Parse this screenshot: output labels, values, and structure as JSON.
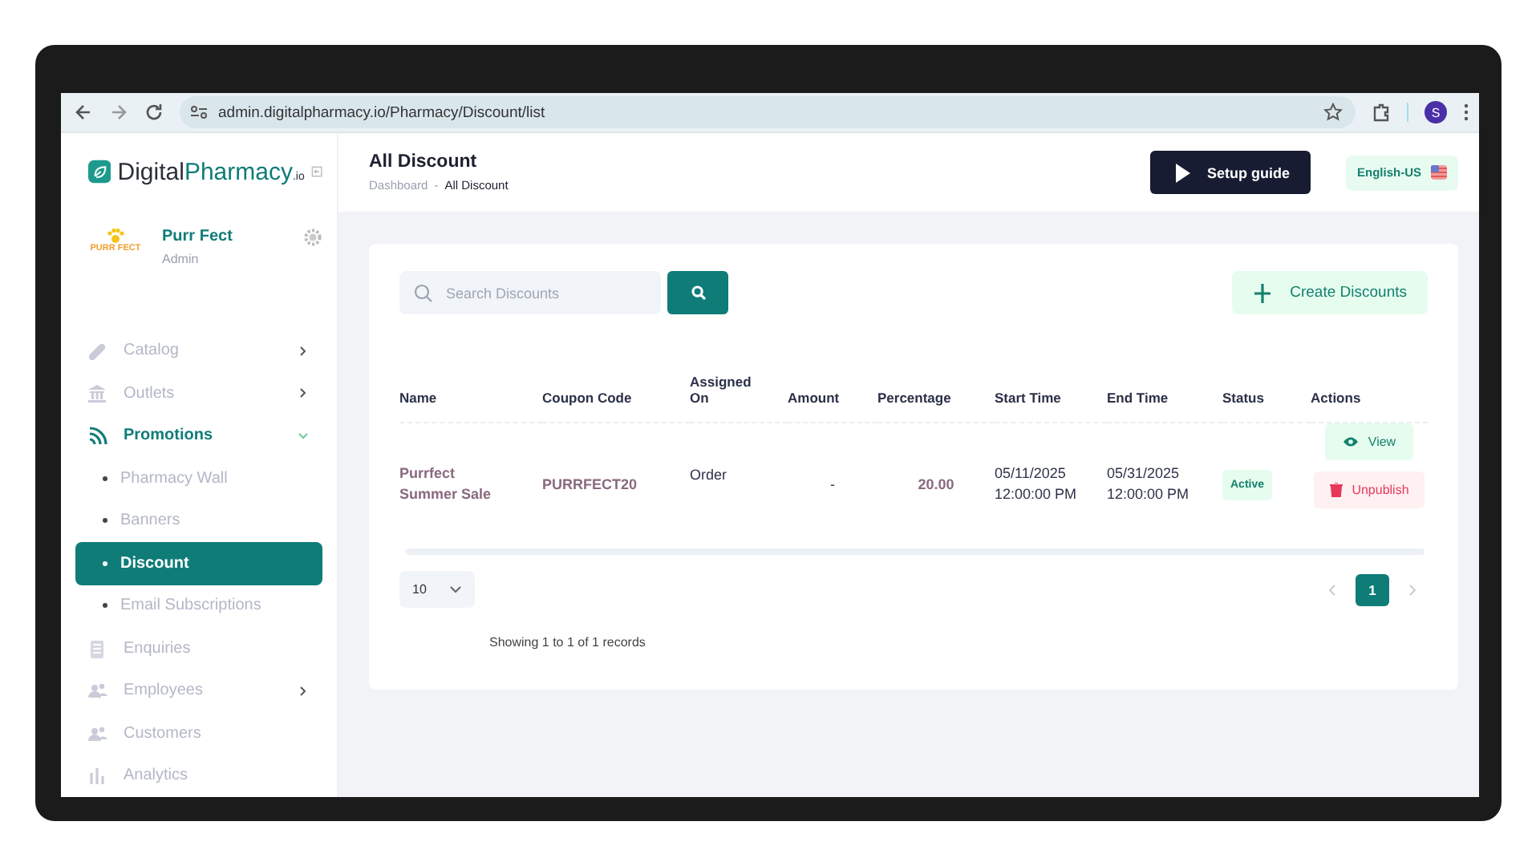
{
  "browser": {
    "url": "admin.digitalpharmacy.io/Pharmacy/Discount/list",
    "profile_initial": "S"
  },
  "brand": {
    "name_part_1": "Digital",
    "name_part_2": "Pharmacy",
    "suffix": ".io"
  },
  "profile": {
    "logo_text": "PURR FECT",
    "name": "Purr Fect",
    "role": "Admin"
  },
  "sidebar": {
    "items": [
      {
        "label": "Catalog",
        "selected": false,
        "expandable": true,
        "expanded": false
      },
      {
        "label": "Outlets",
        "selected": false,
        "expandable": true,
        "expanded": false
      },
      {
        "label": "Promotions",
        "selected": false,
        "expandable": true,
        "expanded": true,
        "children": [
          {
            "label": "Pharmacy Wall",
            "selected": false
          },
          {
            "label": "Banners",
            "selected": false
          },
          {
            "label": "Discount",
            "selected": true
          },
          {
            "label": "Email Subscriptions",
            "selected": false
          }
        ]
      },
      {
        "label": "Enquiries",
        "selected": false,
        "expandable": false,
        "expanded": false
      },
      {
        "label": "Employees",
        "selected": false,
        "expandable": true,
        "expanded": false
      },
      {
        "label": "Customers",
        "selected": false,
        "expandable": false,
        "expanded": false
      },
      {
        "label": "Analytics",
        "selected": false,
        "expandable": false,
        "expanded": false
      }
    ]
  },
  "header": {
    "title": "All Discount",
    "breadcrumb": [
      "Dashboard",
      "All Discount"
    ],
    "breadcrumb_separator": "-",
    "setup_button": "Setup guide",
    "language": "English-US"
  },
  "toolbar": {
    "search_placeholder": "Search Discounts",
    "create_button": "Create Discounts"
  },
  "table": {
    "columns": [
      "Name",
      "Coupon Code",
      "Assigned On",
      "Amount",
      "Percentage",
      "Start Time",
      "End Time",
      "Status",
      "Actions"
    ],
    "rows": [
      {
        "cells": [
          "Purrfect Summer Sale",
          "PURRFECT20",
          "Order",
          "-",
          "20.00",
          "05/11/2025 12:00:00 PM",
          "05/31/2025 12:00:00 PM"
        ],
        "status": "Active",
        "actions": [
          {
            "kind": "view",
            "label": "View"
          },
          {
            "kind": "unpublish",
            "label": "Unpublish"
          }
        ]
      }
    ]
  },
  "pagination": {
    "page_size": "10",
    "pages": [
      {
        "label": "1",
        "selected": true
      }
    ],
    "summary": "Showing 1 to 1 of 1 records"
  }
}
